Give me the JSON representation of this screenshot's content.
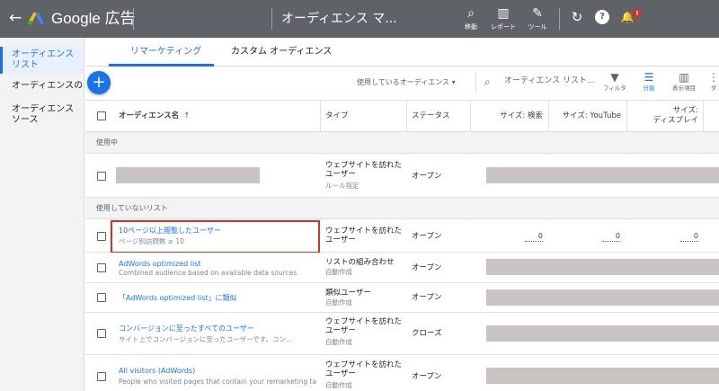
{
  "topbar": {
    "back": "←",
    "brand": "Google 広告",
    "title": "オーディエンス マ...",
    "tools": [
      {
        "icon": "search-icon",
        "glyph": "⌕",
        "label": "移動"
      },
      {
        "icon": "reports-icon",
        "glyph": "▥",
        "label": "レポート"
      },
      {
        "icon": "wrench-icon",
        "glyph": "✎",
        "label": "ツール"
      }
    ],
    "refresh": "↻",
    "help": "?",
    "bell": "🔔",
    "notifications_badge": "!"
  },
  "sidebar": {
    "items": [
      {
        "label": "オーディエンス\nリスト",
        "active": true
      },
      {
        "label": "オーディエンスのイ",
        "active": false
      },
      {
        "label": "オーディエンス\nソース",
        "active": false
      }
    ]
  },
  "tabs": [
    {
      "label": "リマーケティング",
      "active": true
    },
    {
      "label": "カスタム オーディエンス",
      "active": false
    }
  ],
  "toolbar": {
    "add": "+",
    "filter_select": "使用しているオーディエンス ▾",
    "search_placeholder": "オーディエンス リスト...",
    "tools": [
      {
        "icon": "filter-icon",
        "glyph": "▼",
        "label": "フィルタ",
        "active": false
      },
      {
        "icon": "segment-icon",
        "glyph": "☰",
        "label": "分割",
        "active": true
      },
      {
        "icon": "columns-icon",
        "glyph": "▥",
        "label": "表示項目",
        "active": false
      },
      {
        "icon": "more-icon",
        "glyph": "⋮",
        "label": "ダ",
        "active": false
      }
    ]
  },
  "table": {
    "headers": {
      "name": "オーディエンス名",
      "sort": "↑",
      "type": "タイプ",
      "status": "ステータス",
      "size_search": "サイズ: 検索",
      "size_youtube": "サイズ: YouTube",
      "size_display": "サイズ:\nディスプレイ"
    },
    "sections": {
      "in_use": "使用中",
      "not_in_use": "使用していないリスト"
    },
    "rows": [
      {
        "name": "",
        "sub": "",
        "type": "ウェブサイトを訪れた\nユーザー",
        "type_sub": "ルール指定",
        "status": "オープン"
      },
      {
        "name": "10ページ以上閲覧したユーザー",
        "sub": "ページ別訪問数 ≥ 10",
        "type": "ウェブサイトを訪れた\nユーザー",
        "type_sub": "",
        "status": "オープン",
        "sizes": [
          "0",
          "0",
          "0"
        ]
      },
      {
        "name": "AdWords optimized list",
        "sub": "Combined audience based on available data sources",
        "type": "リストの組み合わせ",
        "type_sub": "自動作成",
        "status": "オープン"
      },
      {
        "name": "「AdWords optimized list」に類似",
        "sub": "",
        "type": "類似ユーザー",
        "type_sub": "自動作成",
        "status": "オープン"
      },
      {
        "name": "コンバージョンに至ったすべてのユーザー",
        "sub": "サイト上でコンバージョンに至ったユーザーです。コン...",
        "type": "ウェブサイトを訪れた\nユーザー",
        "type_sub": "自動作成",
        "status": "クローズ"
      },
      {
        "name": "All visitors (AdWords)",
        "sub": "People who visited pages that contain your remarketing ta...",
        "type": "ウェブサイトを訪れた\nユーザー",
        "type_sub": "自動作成",
        "status": "オープン"
      }
    ]
  },
  "colors": {
    "topbar": "#5f6368",
    "accent": "#1a73e8",
    "highlight": "#d93025",
    "redacted": "#c9c3c3"
  }
}
